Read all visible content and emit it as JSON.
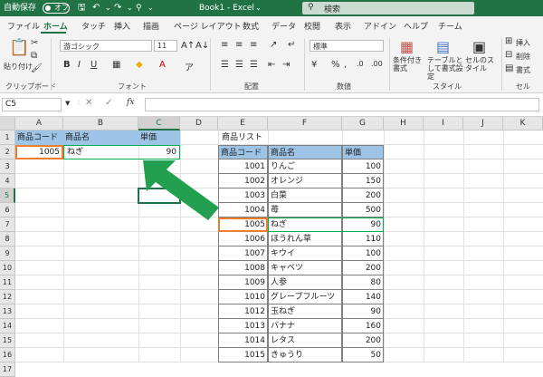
{
  "titlebar": {
    "autosave_label": "自動保存",
    "autosave_state": "オフ",
    "filename": "Book1 - Excel",
    "search_placeholder": "検索"
  },
  "tabs": [
    "ファイル",
    "ホーム",
    "タッチ",
    "挿入",
    "描画",
    "ページ レイアウト",
    "数式",
    "データ",
    "校閲",
    "表示",
    "アドイン",
    "ヘルプ",
    "チーム"
  ],
  "ribbon": {
    "paste_label": "貼り付け",
    "clipboard_label": "クリップボード",
    "font_name": "游ゴシック",
    "font_size": "11",
    "font_group_label": "フォント",
    "align_group_label": "配置",
    "number_format": "標準",
    "number_group_label": "数値",
    "cond_format_label": "条件付き書式",
    "table_format_label": "テーブルとして書式設定",
    "cell_style_label": "セルのスタイル",
    "style_group_label": "スタイル",
    "insert_label": "挿入",
    "delete_label": "削除",
    "format_label": "書式",
    "cells_group_label": "セル"
  },
  "formula": {
    "namebox": "C5",
    "fx": "fx",
    "value": ""
  },
  "columns": [
    "A",
    "B",
    "C",
    "D",
    "E",
    "F",
    "G",
    "H",
    "I",
    "J",
    "K"
  ],
  "rows": [
    "1",
    "2",
    "3",
    "4",
    "5",
    "6",
    "7",
    "8",
    "9",
    "10",
    "11",
    "12",
    "13",
    "14",
    "15",
    "16",
    "17"
  ],
  "lookup": {
    "headers": [
      "商品コード",
      "商品名",
      "単価"
    ],
    "row": [
      "1005",
      "ねぎ",
      "90"
    ]
  },
  "list": {
    "title": "商品リスト",
    "headers": [
      "商品コード",
      "商品名",
      "単価"
    ],
    "items": [
      [
        "1001",
        "りんご",
        "100"
      ],
      [
        "1002",
        "オレンジ",
        "150"
      ],
      [
        "1003",
        "白菜",
        "200"
      ],
      [
        "1004",
        "苺",
        "500"
      ],
      [
        "1005",
        "ねぎ",
        "90"
      ],
      [
        "1006",
        "ほうれん草",
        "110"
      ],
      [
        "1007",
        "キウイ",
        "100"
      ],
      [
        "1008",
        "キャベツ",
        "200"
      ],
      [
        "1009",
        "人参",
        "80"
      ],
      [
        "1010",
        "グレープフルーツ",
        "140"
      ],
      [
        "1012",
        "玉ねぎ",
        "90"
      ],
      [
        "1013",
        "バナナ",
        "160"
      ],
      [
        "1014",
        "レタス",
        "200"
      ],
      [
        "1015",
        "きゅうり",
        "50"
      ]
    ]
  },
  "colors": {
    "excel_green": "#217346",
    "header_fill": "#9dc3e6",
    "orange_highlight": "#ed7d31",
    "green_highlight": "#00b050",
    "arrow": "#22a050"
  }
}
